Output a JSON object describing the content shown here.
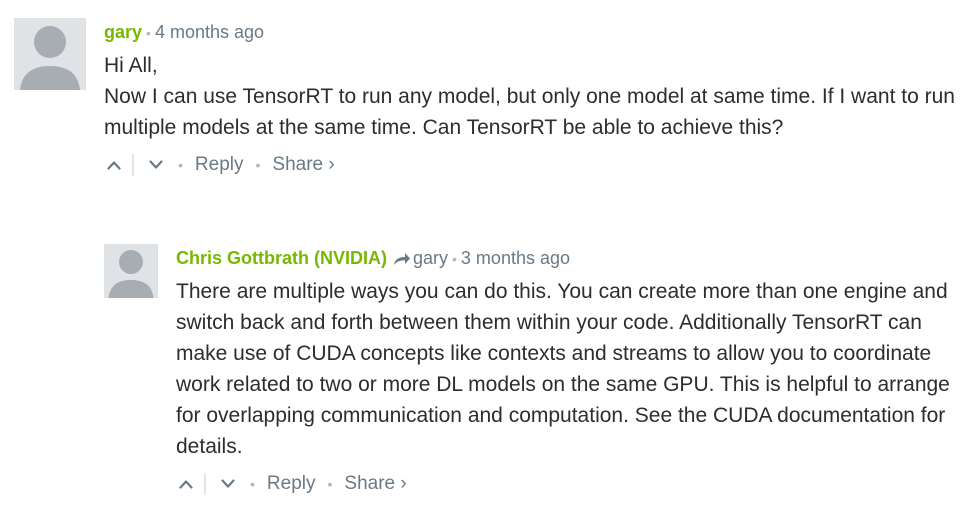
{
  "comments": [
    {
      "author": "gary",
      "time": "4 months ago",
      "lines": [
        "Hi All,",
        "Now I can use TensorRT to run any model, but only one model at same time. If I want to run multiple models at the same time. Can TensorRT be able to achieve this?"
      ],
      "actions": {
        "reply": "Reply",
        "share": "Share ›"
      }
    },
    {
      "author": "Chris Gottbrath (NVIDIA)",
      "parent": "gary",
      "time": "3 months ago",
      "lines": [
        "There are multiple ways you can do this. You can create more than one engine and switch back and forth between them within your code. Additionally TensorRT can make use of CUDA concepts like contexts and streams to allow you to coordinate work related to two or more DL models on the same GPU. This is helpful to arrange for overlapping communication and computation. See the CUDA documentation for details."
      ],
      "actions": {
        "reply": "Reply",
        "share": "Share ›"
      }
    }
  ],
  "separators": {
    "bullet": "•"
  },
  "colors": {
    "author": "#76b900",
    "meta": "#687a86",
    "text": "#2a2e2e",
    "avatar_bg": "#dfe3e6",
    "avatar_fg": "#a7adb3"
  },
  "icons": [
    "default-avatar-icon",
    "upvote-icon",
    "downvote-icon",
    "reply-arrow-icon"
  ]
}
